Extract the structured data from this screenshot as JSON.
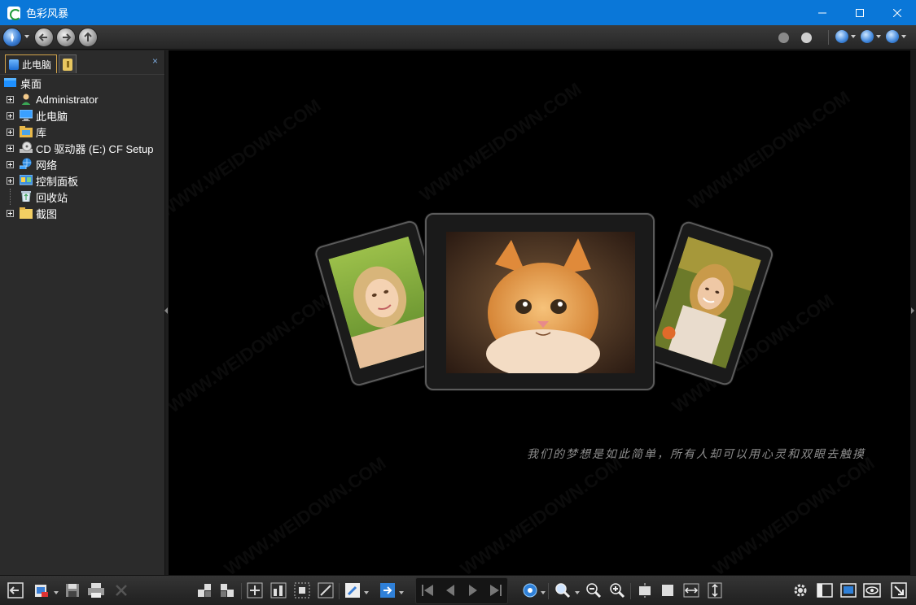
{
  "window": {
    "title": "色彩风暴",
    "minimize_glyph": "—",
    "maximize_glyph": "☐",
    "close_glyph": "✕"
  },
  "sidebar": {
    "tabs": [
      {
        "label": "此电脑",
        "icon": "computer-icon"
      },
      {
        "label": "",
        "icon": "favorites-icon"
      }
    ],
    "close_glyph": "×",
    "tree": [
      {
        "label": "桌面",
        "icon": "desktop-icon",
        "expandable": false
      },
      {
        "label": "Administrator",
        "icon": "user-icon",
        "expandable": true
      },
      {
        "label": "此电脑",
        "icon": "computer-icon",
        "expandable": true
      },
      {
        "label": "库",
        "icon": "library-icon",
        "expandable": true
      },
      {
        "label": "CD 驱动器 (E:) CF Setup",
        "icon": "cd-drive-icon",
        "expandable": true
      },
      {
        "label": "网络",
        "icon": "network-icon",
        "expandable": true
      },
      {
        "label": "控制面板",
        "icon": "control-panel-icon",
        "expandable": true
      },
      {
        "label": "回收站",
        "icon": "recycle-bin-icon",
        "expandable": false
      },
      {
        "label": "截图",
        "icon": "folder-icon",
        "expandable": true
      }
    ]
  },
  "viewer": {
    "caption": "我们的梦想是如此简单，所有人却可以用心灵和双眼去触摸",
    "watermark": "WWW.WEIDOWN.COM"
  },
  "colors": {
    "titlebar": "#0a77d8",
    "panel": "#2b2b2b",
    "viewer_bg": "#000000"
  }
}
